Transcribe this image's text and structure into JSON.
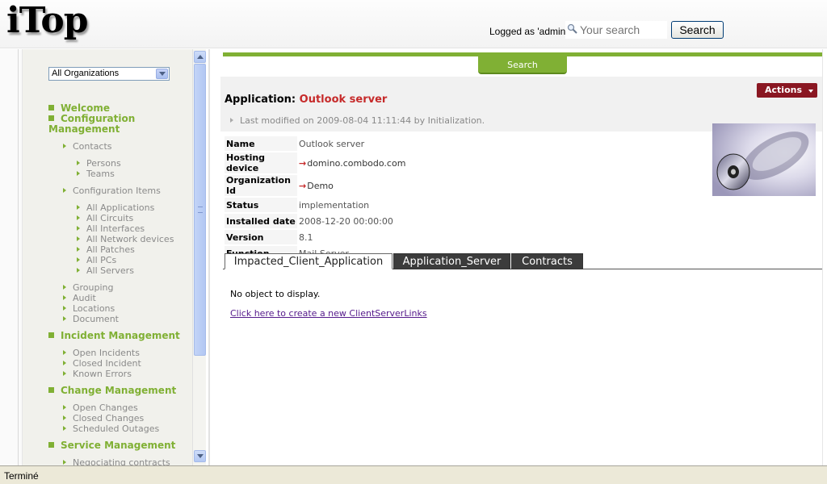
{
  "header": {
    "logo": "iTop",
    "logged_as": "Logged as 'admin'",
    "search_placeholder": "Your search",
    "search_button": "Search"
  },
  "sidebar": {
    "org_select": "All Organizations",
    "welcome": "Welcome",
    "config_mgmt_line1": "Configuration",
    "config_mgmt_line2": "Management",
    "contacts": "Contacts",
    "persons": "Persons",
    "teams": "Teams",
    "config_items": "Configuration Items",
    "all_applications": "All Applications",
    "all_circuits": "All Circuits",
    "all_interfaces": "All Interfaces",
    "all_network_devices": "All Network devices",
    "all_patches": "All Patches",
    "all_pcs": "All PCs",
    "all_servers": "All Servers",
    "grouping": "Grouping",
    "audit": "Audit",
    "locations": "Locations",
    "document": "Document",
    "incident_mgmt": "Incident Management",
    "open_incidents": "Open Incidents",
    "closed_incident": "Closed Incident",
    "known_errors": "Known Errors",
    "change_mgmt": "Change Management",
    "open_changes": "Open Changes",
    "closed_changes": "Closed Changes",
    "scheduled_outages": "Scheduled Outages",
    "service_mgmt": "Service Management",
    "negotiating_contracts": "Negociating contracts"
  },
  "main": {
    "search_tab": "Search",
    "actions": "Actions",
    "title_prefix": "Application: ",
    "title_name": "Outlook server",
    "last_modified": "Last modified on 2009-08-04 11:11:44 by Initialization.",
    "details": {
      "name_label": "Name",
      "name_value": "Outlook server",
      "hosting_label": "Hosting device",
      "hosting_value": "domino.combodo.com",
      "org_label": "Organization Id",
      "org_value": "Demo",
      "status_label": "Status",
      "status_value": "implementation",
      "installed_label": "Installed date",
      "installed_value": "2008-12-20 00:00:00",
      "version_label": "Version",
      "version_value": "8.1",
      "function_label": "Function",
      "function_value": "Mail Server"
    },
    "tabs": {
      "tab1": "Impacted_Client_Application",
      "tab2": "Application_Server",
      "tab3": "Contracts"
    },
    "no_object": "No object to display.",
    "create_link": "Click here to create a new ClientServerLinks"
  },
  "statusbar": {
    "text": "Terminé"
  },
  "colors": {
    "accent_green": "#80b034",
    "actions_red": "#8a1722",
    "title_red": "#c62a2a"
  }
}
